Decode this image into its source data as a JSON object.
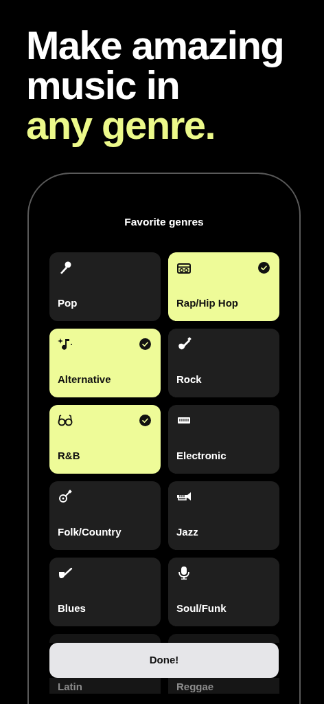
{
  "headline": {
    "lines": [
      {
        "text": "Make amazing",
        "accent": false
      },
      {
        "text": "music in",
        "accent": false
      },
      {
        "text": "any genre.",
        "accent": true
      }
    ]
  },
  "screen": {
    "title": "Favorite genres"
  },
  "genres": [
    {
      "label": "Pop",
      "selected": false
    },
    {
      "label": "Rap/Hip Hop",
      "selected": true
    },
    {
      "label": "Alternative",
      "selected": true
    },
    {
      "label": "Rock",
      "selected": false
    },
    {
      "label": "R&B",
      "selected": true
    },
    {
      "label": "Electronic",
      "selected": false
    },
    {
      "label": "Folk/Country",
      "selected": false
    },
    {
      "label": "Jazz",
      "selected": false
    },
    {
      "label": "Blues",
      "selected": false
    },
    {
      "label": "Soul/Funk",
      "selected": false
    },
    {
      "label": "Latin",
      "selected": false
    },
    {
      "label": "Reggae",
      "selected": false
    }
  ],
  "done_button": {
    "label": "Done!"
  }
}
